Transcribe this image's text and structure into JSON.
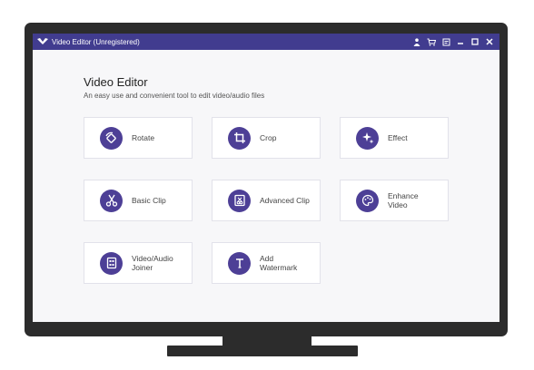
{
  "window": {
    "title": "Video Editor (Unregistered)",
    "icons": [
      "app-logo-icon",
      "user-icon",
      "cart-icon",
      "feedback-icon",
      "minimize-icon",
      "maximize-icon",
      "close-icon"
    ]
  },
  "header": {
    "title": "Video Editor",
    "subtitle": "An easy use and convenient tool to edit video/audio files"
  },
  "tools": [
    {
      "label": "Rotate",
      "icon": "rotate-icon"
    },
    {
      "label": "Crop",
      "icon": "crop-icon"
    },
    {
      "label": "Effect",
      "icon": "effect-icon"
    },
    {
      "label": "Basic Clip",
      "icon": "scissors-icon"
    },
    {
      "label": "Advanced Clip",
      "icon": "advanced-clip-icon"
    },
    {
      "label": "Enhance\nVideo",
      "icon": "palette-icon"
    },
    {
      "label": "Video/Audio\nJoiner",
      "icon": "joiner-icon"
    },
    {
      "label": "Add\nWatermark",
      "icon": "text-watermark-icon"
    }
  ],
  "colors": {
    "accent": "#413c8f",
    "icon_bg": "#4d3f96",
    "frame": "#2c2c2c"
  }
}
